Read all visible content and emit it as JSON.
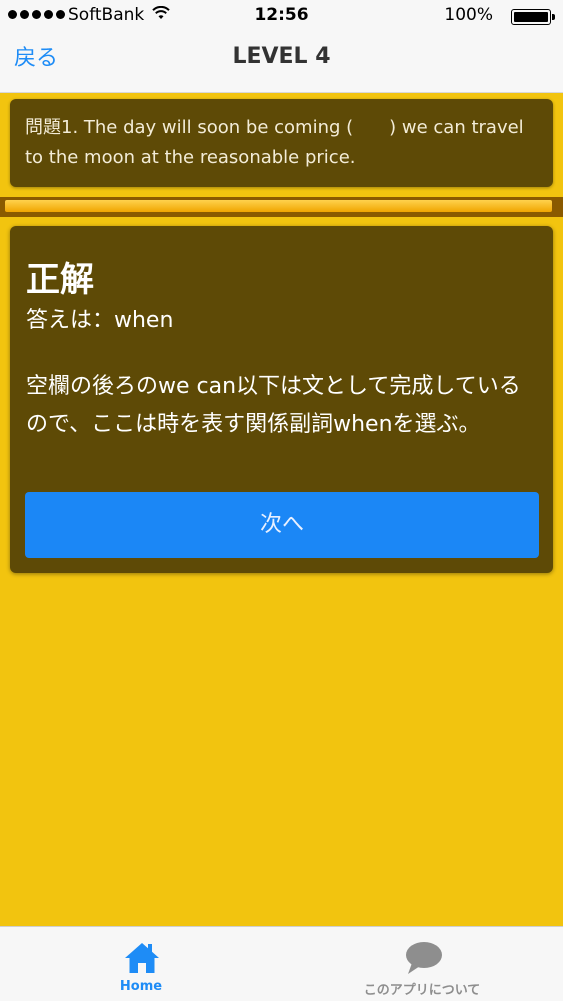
{
  "status_bar": {
    "carrier": "SoftBank",
    "time": "12:56",
    "battery": "100%"
  },
  "nav": {
    "back_label": "戻る",
    "title": "LEVEL 4"
  },
  "question": {
    "text": "問題1. The day will soon be coming (　　) we can travel to the moon at the reasonable price."
  },
  "progress": {
    "value": 0.99
  },
  "answer_panel": {
    "result": "正解",
    "answer": "答えは：when",
    "explanation": "空欄の後ろのwe can以下は文として完成しているので、ここは時を表す関係副詞whenを選ぶ。",
    "next_button": "次へ"
  },
  "tab_bar": {
    "tabs": [
      {
        "label": "Home",
        "icon": "home-icon",
        "selected": true
      },
      {
        "label": "このアプリについて",
        "icon": "speech-bubble-icon",
        "selected": false
      }
    ]
  },
  "colors": {
    "background": "#f2c40f",
    "panel": "#5e4a06",
    "accent": "#1e8cf6",
    "button": "#1b87f6"
  }
}
